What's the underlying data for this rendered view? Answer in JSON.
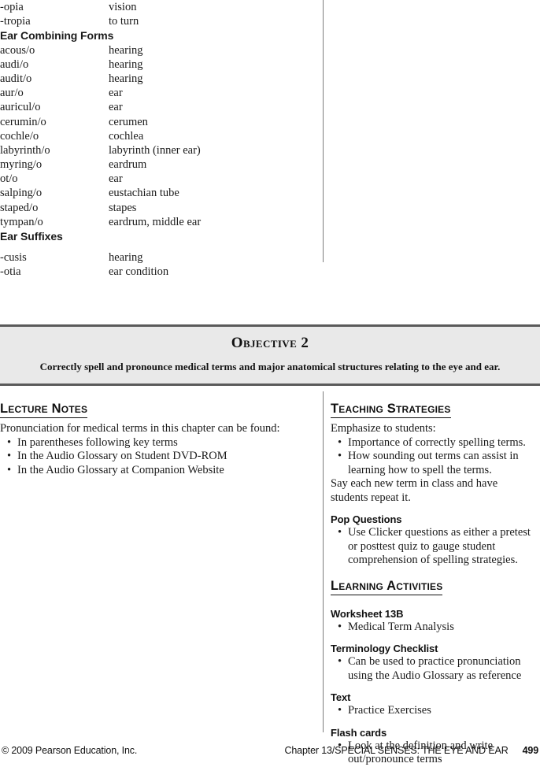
{
  "glossary": {
    "rows": [
      {
        "kind": "entry",
        "term": "-opia",
        "definition": "vision"
      },
      {
        "kind": "entry",
        "term": "-tropia",
        "definition": "to turn"
      },
      {
        "kind": "heading",
        "term": "Ear Combining Forms",
        "definition": ""
      },
      {
        "kind": "entry",
        "term": "acous/o",
        "definition": "hearing"
      },
      {
        "kind": "entry",
        "term": "audi/o",
        "definition": "hearing"
      },
      {
        "kind": "entry",
        "term": "audit/o",
        "definition": "hearing"
      },
      {
        "kind": "entry",
        "term": "aur/o",
        "definition": "ear"
      },
      {
        "kind": "entry",
        "term": "auricul/o",
        "definition": "ear"
      },
      {
        "kind": "entry",
        "term": "cerumin/o",
        "definition": "cerumen"
      },
      {
        "kind": "entry",
        "term": "cochle/o",
        "definition": "cochlea"
      },
      {
        "kind": "entry",
        "term": "labyrinth/o",
        "definition": "labyrinth (inner ear)"
      },
      {
        "kind": "entry",
        "term": "myring/o",
        "definition": "eardrum"
      },
      {
        "kind": "entry",
        "term": "ot/o",
        "definition": "ear"
      },
      {
        "kind": "entry",
        "term": "salping/o",
        "definition": "eustachian tube"
      },
      {
        "kind": "entry",
        "term": "staped/o",
        "definition": "stapes"
      },
      {
        "kind": "entry",
        "term": "tympan/o",
        "definition": "eardrum, middle ear"
      },
      {
        "kind": "heading",
        "term": "Ear Suffixes",
        "definition": ""
      },
      {
        "kind": "spacer",
        "term": "",
        "definition": ""
      },
      {
        "kind": "entry",
        "term": "-cusis",
        "definition": "hearing"
      },
      {
        "kind": "entry",
        "term": "-otia",
        "definition": "ear condition"
      }
    ]
  },
  "objective": {
    "title": "Objective 2",
    "subtitle": "Correctly spell and pronounce medical terms and major anatomical structures relating to the eye and ear."
  },
  "lecture_notes": {
    "heading": "Lecture Notes",
    "intro": "Pronunciation for medical terms in this chapter can be found:",
    "bullets": [
      "In parentheses following key terms",
      "In the Audio Glossary on Student DVD-ROM",
      "In the Audio Glossary at Companion Website"
    ]
  },
  "teaching_strategies": {
    "heading": "Teaching Strategies",
    "intro": "Emphasize to students:",
    "bullets": [
      "Importance of correctly spelling terms.",
      "How sounding out terms can assist in learning how to spell the terms."
    ],
    "closing": "Say each new term in class and have students repeat it.",
    "pop_questions": {
      "heading": "Pop Questions",
      "bullets": [
        "Use Clicker questions as either a pretest or posttest quiz to gauge student comprehension of spelling strategies."
      ]
    }
  },
  "learning_activities": {
    "heading": "Learning Activities",
    "subsections": [
      {
        "heading": "Worksheet 13B",
        "bullets": [
          "Medical Term Analysis"
        ]
      },
      {
        "heading": "Terminology Checklist",
        "bullets": [
          "Can be used to practice pronunciation using the Audio Glossary as reference"
        ]
      },
      {
        "heading": "Text",
        "bullets": [
          "Practice Exercises"
        ]
      },
      {
        "heading": "Flash cards",
        "bullets": [
          "Look at the definition and write out/pronounce terms"
        ]
      }
    ]
  },
  "footer": {
    "copyright": "© 2009 Pearson Education, Inc.",
    "chapter": "Chapter 13/SPECIAL SENSES: THE EYE AND EAR",
    "page_number": "499"
  }
}
